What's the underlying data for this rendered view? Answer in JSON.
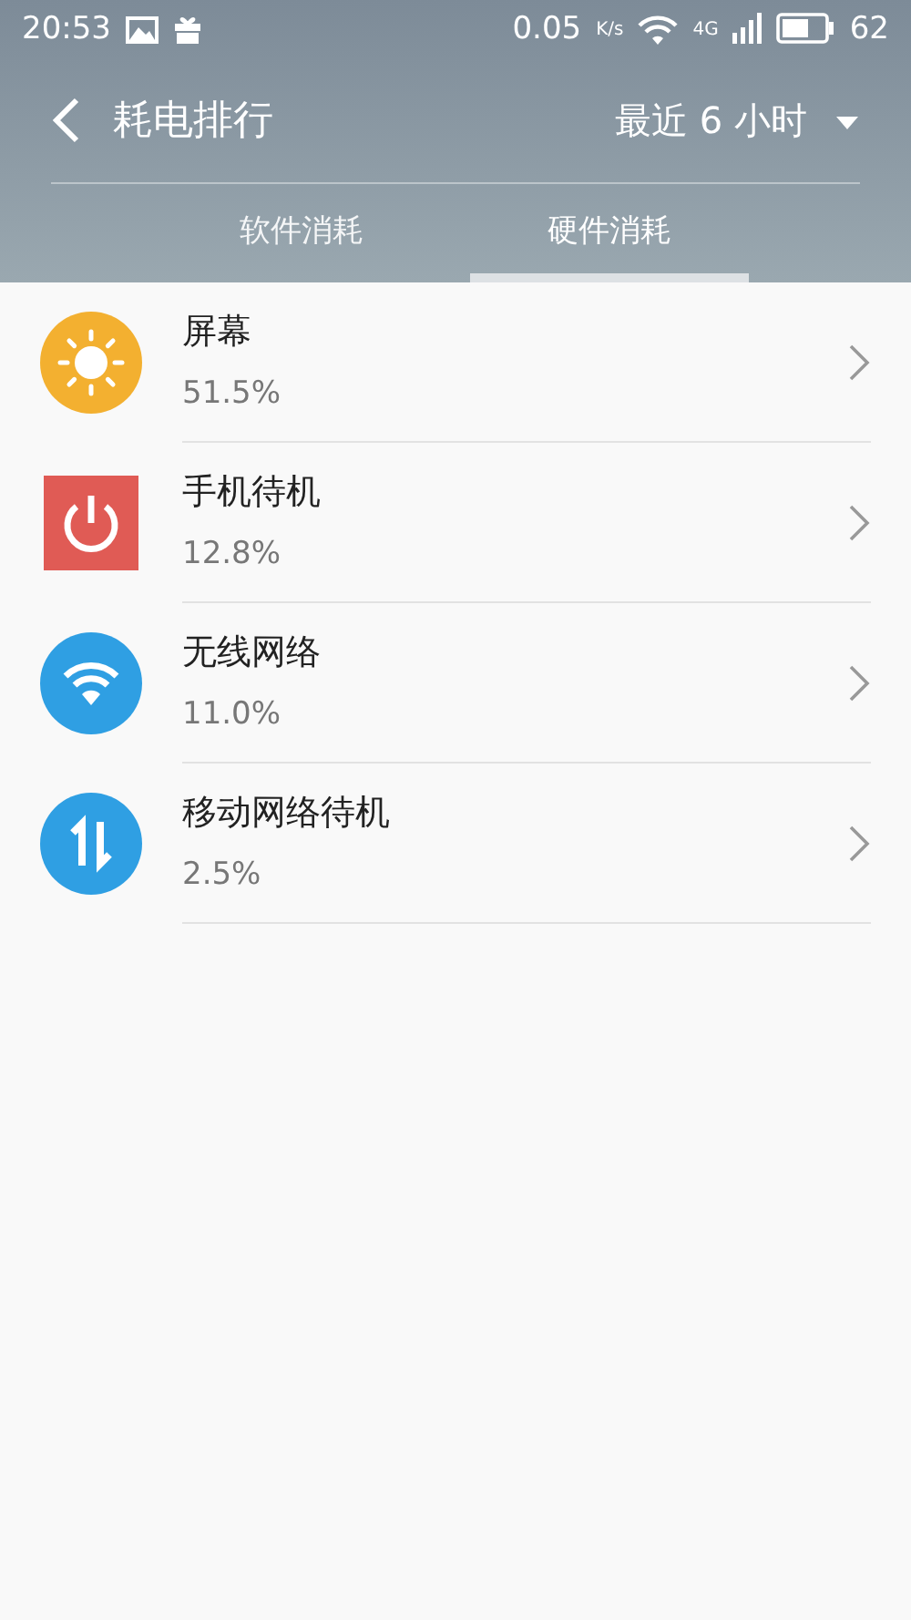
{
  "status_bar": {
    "time": "20:53",
    "speed": "0.05",
    "speed_unit": "K/s",
    "network": "4G",
    "battery": "62"
  },
  "header": {
    "title": "耗电排行",
    "period": "最近 6 小时"
  },
  "tabs": [
    {
      "label": "软件消耗",
      "selected": false
    },
    {
      "label": "硬件消耗",
      "selected": true
    }
  ],
  "items": [
    {
      "kind": "sun",
      "color": "#f3b030",
      "name": "屏幕",
      "value": "51.5%"
    },
    {
      "kind": "power",
      "color": "#e05b55",
      "name": "手机待机",
      "value": "12.8%"
    },
    {
      "kind": "wifi",
      "color": "#2f9fe3",
      "name": "无线网络",
      "value": "11.0%"
    },
    {
      "kind": "data",
      "color": "#2f9fe3",
      "name": "移动网络待机",
      "value": "2.5%"
    }
  ]
}
